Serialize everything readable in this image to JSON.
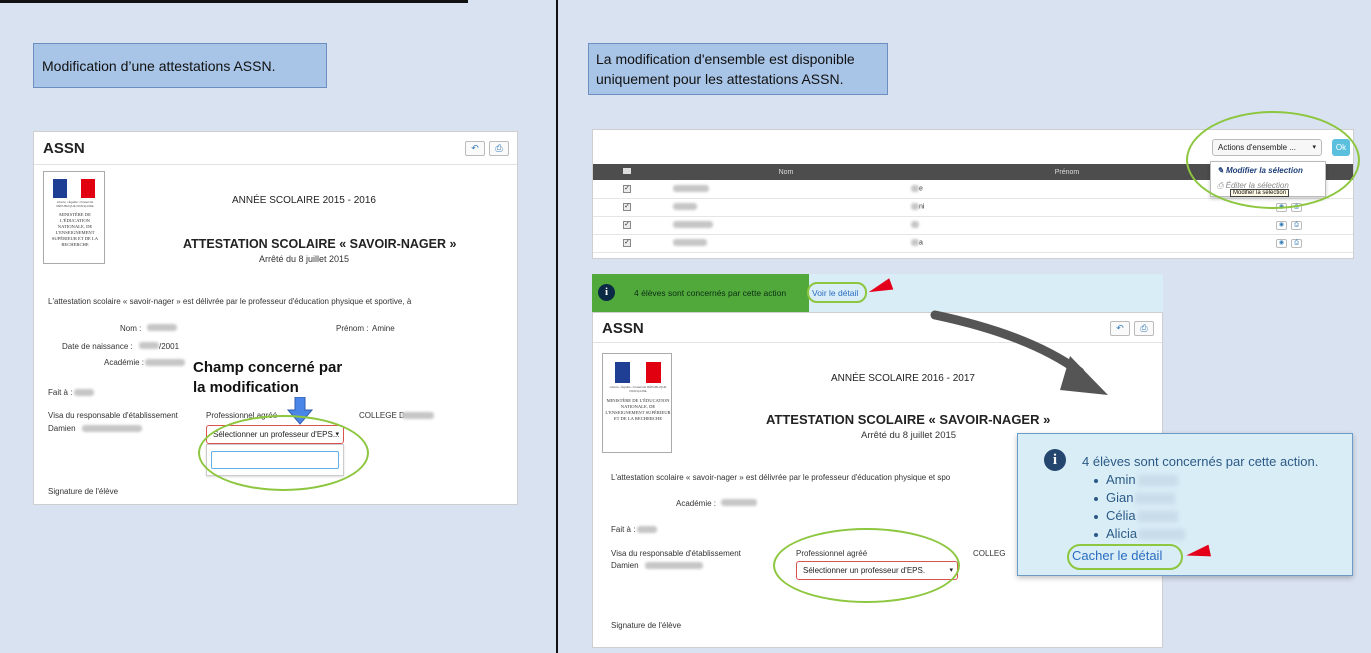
{
  "left_callout": "Modification d’une attestations ASSN.",
  "right_callout": {
    "line1": "La modification d'ensemble est disponible",
    "line2": "uniquement pour les attestations ASSN."
  },
  "form_left": {
    "title": "ASSN",
    "year": "ANNÉE SCOLAIRE   2015  - 2016",
    "attestation_title": "ATTESTATION SCOLAIRE « SAVOIR-NAGER »",
    "decree": "Arrêté du 8 juillet 2015",
    "intro": "L'attestation scolaire « savoir-nager » est délivrée par le professeur d'éducation physique et sportive, à",
    "nom_label": "Nom :",
    "prenom_label": "Prénom :",
    "prenom_value": "Amine",
    "dob_label": "Date de naissance :",
    "dob_suffix": "/2001",
    "academie_label": "Académie :",
    "fait_label": "Fait à :",
    "visa_label": "Visa du responsable d'établissement",
    "visa_name": "Damien",
    "pro_label": "Professionnel agréé",
    "college_label": "COLLEGE D",
    "select_text": "Sélectionner un professeur d'EPS...",
    "signature_label": "Signature de l'élève"
  },
  "annotation": {
    "line1": "Champ concerné par",
    "line2": "la modification"
  },
  "logo": {
    "motto": "Liberté • Égalité • Fraternité RÉPUBLIQUE FRANÇAISE",
    "ministry": "MINISTÈRE DE L'ÉDUCATION NATIONALE, DE L'ENSEIGNEMENT SUPÉRIEUR ET DE LA RECHERCHE"
  },
  "table": {
    "headers": [
      "Nom",
      "Prénom"
    ],
    "rows": [
      {
        "prenom_tail": "e"
      },
      {
        "prenom_tail": "ni"
      },
      {
        "prenom_tail": ""
      },
      {
        "prenom_tail": "a"
      }
    ],
    "actions_label": "Actions d'ensemble ...",
    "ok_label": "Ok",
    "menu": [
      "Modifier la sélection",
      "Éditer la sélection"
    ],
    "tooltip": "Modifier la sélection"
  },
  "alert": {
    "text": "4 élèves sont concernés par cette action",
    "link": "Voir le détail"
  },
  "form_right": {
    "title": "ASSN",
    "year": "ANNÉE SCOLAIRE   2016  - 2017",
    "attestation_title": "ATTESTATION SCOLAIRE « SAVOIR-NAGER »",
    "decree": "Arrêté du 8 juillet 2015",
    "intro": "L'attestation scolaire « savoir-nager » est délivrée par le professeur d'éducation physique et spo",
    "academie_label": "Académie :",
    "fait_label": "Fait à :",
    "visa_label": "Visa du responsable d'établissement",
    "visa_name": "Damien",
    "pro_label": "Professionnel agréé",
    "college_label": "COLLEG",
    "select_text": "Sélectionner un professeur d'EPS.",
    "signature_label": "Signature de l'élève"
  },
  "popup": {
    "text": "4 élèves sont concernés par cette action.",
    "students": [
      "Amin",
      "Gian",
      "Célia",
      "Alicia"
    ],
    "link": "Cacher le détail"
  },
  "colors": {
    "background": "#d9e2f1",
    "callout": "#a8c4e6",
    "highlight_ellipse": "#8dc63f",
    "alert_green": "#51a93b",
    "info_blue": "#d9edf7",
    "red_arrow": "#e4001b",
    "annotation_arrow": "#4a86e8"
  },
  "icons": [
    "undo-icon",
    "print-icon",
    "info-icon",
    "pencil-icon",
    "eye-icon",
    "checkbox-icon",
    "caret-down-icon"
  ]
}
